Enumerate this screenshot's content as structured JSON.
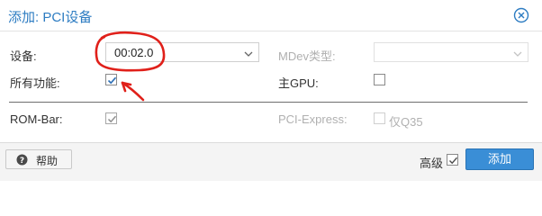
{
  "dialog": {
    "title": "添加: PCI设备",
    "close_icon": "close-circle-icon"
  },
  "fields": {
    "device_label": "设备:",
    "device_value": "00:02.0",
    "mdev_label": "MDev类型:",
    "mdev_value": "",
    "all_functions_label": "所有功能:",
    "all_functions_checked": true,
    "primary_gpu_label": "主GPU:",
    "primary_gpu_checked": false,
    "rombar_label": "ROM-Bar:",
    "rombar_checked": true,
    "pcie_label": "PCI-Express:",
    "pcie_checked": false,
    "q35_label": "仅Q35"
  },
  "footer": {
    "help_label": "帮助",
    "help_icon": "question-circle-icon",
    "advanced_label": "高级",
    "advanced_checked": true,
    "add_label": "添加"
  },
  "colors": {
    "accent": "#3a8ed6",
    "title": "#2d7cc2",
    "annotation": "#e0201a"
  }
}
